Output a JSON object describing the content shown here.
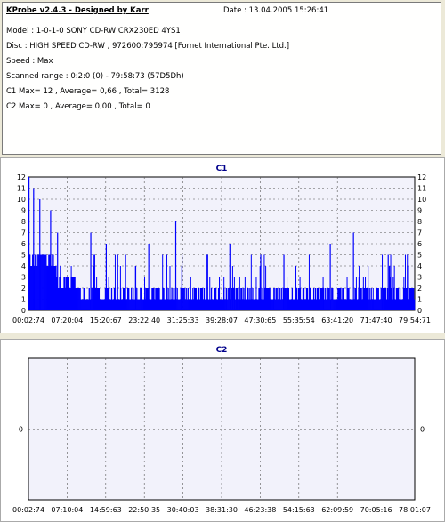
{
  "header": {
    "title": "KProbe v2.4.3 - Designed by Karr",
    "date": "Date : 13.04.2005 15:26:41",
    "lines": [
      "Model : 1-0-1-0 SONY    CD-RW  CRX230ED  4YS1",
      "Disc : HIGH SPEED CD-RW , 972600:795974 [Fornet International Pte. Ltd.]",
      "Speed : Max",
      "Scanned range : 0:2:0 (0) - 79:58:73 (57D5Dh)",
      "C1 Max= 12 , Average= 0,66 , Total= 3128",
      "C2 Max= 0 , Average= 0,00 , Total= 0"
    ]
  },
  "chart_data": [
    {
      "type": "bar",
      "title": "C1",
      "ylim": [
        0,
        12
      ],
      "yticks": [
        "0",
        "1",
        "2",
        "3",
        "4",
        "5",
        "6",
        "7",
        "8",
        "9",
        "10",
        "11",
        "12"
      ],
      "xticks": [
        "00:02:74",
        "07:20:04",
        "15:20:67",
        "23:22:40",
        "31:25:33",
        "39:28:07",
        "47:30:65",
        "55:35:54",
        "63:41:20",
        "71:47:40",
        "79:54:71"
      ],
      "grid": true,
      "color": "#0000ff",
      "summary": {
        "max": 12,
        "average": 0.66,
        "total": 3128
      },
      "spikes": [
        {
          "x": 0.0,
          "y": 12
        },
        {
          "x": 0.012,
          "y": 11
        },
        {
          "x": 0.028,
          "y": 10
        },
        {
          "x": 0.056,
          "y": 9
        },
        {
          "x": 0.074,
          "y": 7
        },
        {
          "x": 0.16,
          "y": 7
        },
        {
          "x": 0.2,
          "y": 6
        },
        {
          "x": 0.25,
          "y": 5
        },
        {
          "x": 0.31,
          "y": 6
        },
        {
          "x": 0.38,
          "y": 8
        },
        {
          "x": 0.46,
          "y": 5
        },
        {
          "x": 0.52,
          "y": 6
        },
        {
          "x": 0.6,
          "y": 5
        },
        {
          "x": 0.66,
          "y": 5
        },
        {
          "x": 0.78,
          "y": 6
        },
        {
          "x": 0.84,
          "y": 7
        },
        {
          "x": 0.93,
          "y": 5
        },
        {
          "x": 0.98,
          "y": 4
        }
      ]
    },
    {
      "type": "line",
      "title": "C2",
      "ylim": [
        -1,
        1
      ],
      "yticks": [
        "0"
      ],
      "xticks": [
        "00:02:74",
        "07:10:04",
        "14:59:63",
        "22:50:35",
        "30:40:03",
        "38:31:30",
        "46:23:38",
        "54:15:63",
        "62:09:59",
        "70:05:16",
        "78:01:07"
      ],
      "grid": true,
      "values": [
        0
      ]
    }
  ]
}
